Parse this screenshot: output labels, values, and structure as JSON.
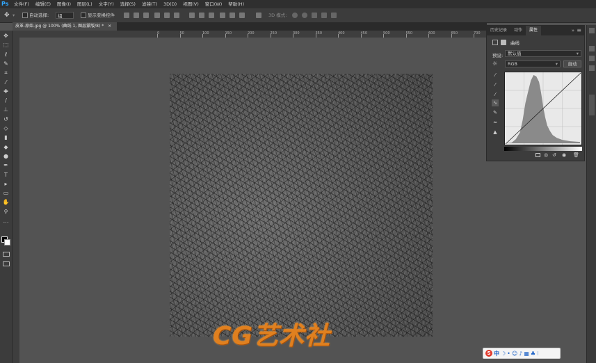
{
  "app": {
    "logo": "Ps"
  },
  "menus": [
    "文件(F)",
    "编辑(E)",
    "图像(I)",
    "图层(L)",
    "文字(Y)",
    "选择(S)",
    "滤镜(T)",
    "3D(D)",
    "视图(V)",
    "窗口(W)",
    "帮助(H)"
  ],
  "options": {
    "auto_select_label": "自动选择:",
    "auto_select_value": "组",
    "show_transform_label": "显示变换控件",
    "mode_3d_label": "3D 模式:"
  },
  "document_tab": {
    "title": "皮革-原始.jpg @ 100% (曲线 1, 图层蒙版/8) *",
    "close": "×"
  },
  "ruler_ticks": [
    "0",
    "50",
    "100",
    "150",
    "200",
    "250",
    "300",
    "350",
    "400",
    "450",
    "500",
    "550",
    "600",
    "650",
    "700",
    "750",
    "800",
    "850",
    "900",
    "950",
    "1000"
  ],
  "tools": [
    {
      "icon": "move-icon",
      "glyph": "✥"
    },
    {
      "icon": "marquee-icon",
      "glyph": "⬚"
    },
    {
      "icon": "lasso-icon",
      "glyph": "ℓ"
    },
    {
      "icon": "quick-select-icon",
      "glyph": "✎"
    },
    {
      "icon": "crop-icon",
      "glyph": "⌗"
    },
    {
      "icon": "eyedropper-icon",
      "glyph": "⁄"
    },
    {
      "icon": "healing-icon",
      "glyph": "✚"
    },
    {
      "icon": "brush-icon",
      "glyph": "/"
    },
    {
      "icon": "stamp-icon",
      "glyph": "⊥"
    },
    {
      "icon": "history-brush-icon",
      "glyph": "↺"
    },
    {
      "icon": "eraser-icon",
      "glyph": "◇"
    },
    {
      "icon": "gradient-icon",
      "glyph": "▮"
    },
    {
      "icon": "blur-icon",
      "glyph": "◆"
    },
    {
      "icon": "dodge-icon",
      "glyph": "●"
    },
    {
      "icon": "pen-icon",
      "glyph": "✒"
    },
    {
      "icon": "type-icon",
      "glyph": "T"
    },
    {
      "icon": "path-select-icon",
      "glyph": "▸"
    },
    {
      "icon": "rectangle-icon",
      "glyph": "▭"
    },
    {
      "icon": "hand-icon",
      "glyph": "✋"
    },
    {
      "icon": "zoom-icon",
      "glyph": "⚲"
    },
    {
      "icon": "more-tools-icon",
      "glyph": "…"
    }
  ],
  "panel": {
    "tabs": [
      "历史记录",
      "动作",
      "属性"
    ],
    "active_tab": 2,
    "icons_label": "曲线",
    "preset_label": "预设:",
    "preset_value": "默认值",
    "channel_value": "RGB",
    "auto_label": "自动",
    "expand": "»",
    "menu": "≡"
  },
  "watermark": "CG艺术社",
  "ime_widget": {
    "brand": "S",
    "lang": "中"
  },
  "colors": {
    "menubar": "#2f2f2f",
    "panel": "#3c3c3c",
    "workspace": "#535353",
    "accent": "#31a8ff",
    "watermark": "#e0801f"
  }
}
